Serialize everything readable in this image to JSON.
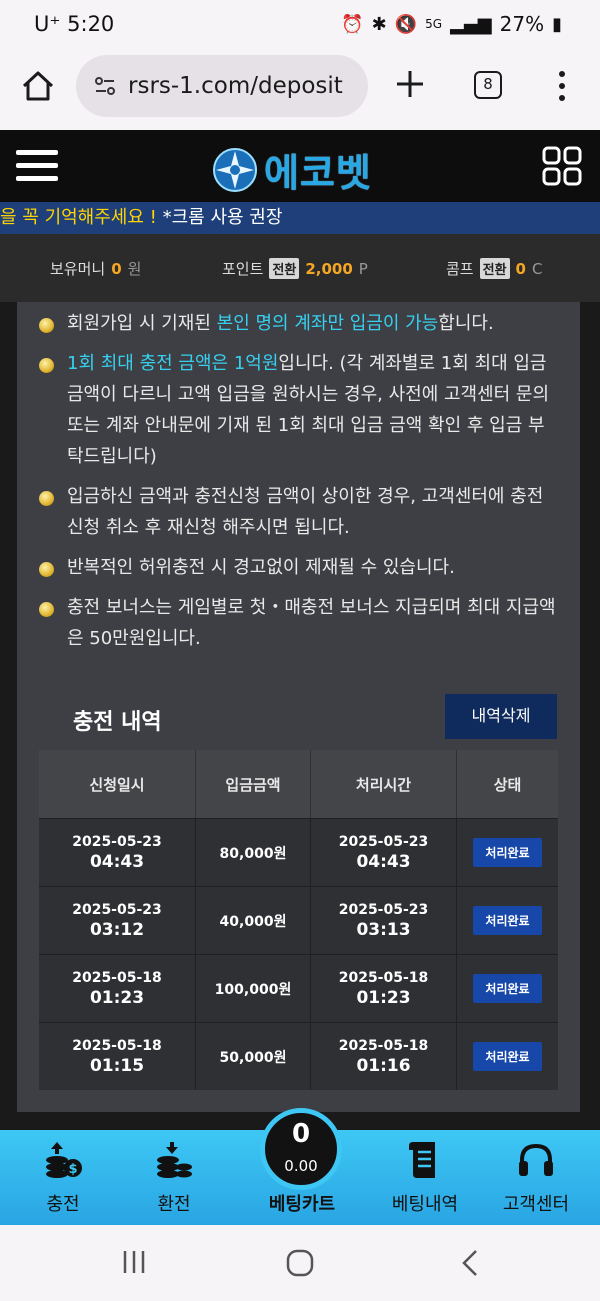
{
  "status_bar": {
    "carrier": "U⁺ 5:20",
    "battery": "27%",
    "network": "5G"
  },
  "browser": {
    "url": "rsrs-1.com/deposit",
    "tab_count": "8"
  },
  "site": {
    "logo_text": "에코벳"
  },
  "marquee": {
    "highlight": "을 꼭 기억해주세요 !",
    "text": " *크롬 사용 권장"
  },
  "balance": {
    "money_label": "보유머니",
    "money_value": "0",
    "money_unit": "원",
    "point_label": "포인트",
    "point_tag": "전환",
    "point_value": "2,000",
    "point_unit": "P",
    "comp_label": "콤프",
    "comp_tag": "전환",
    "comp_value": "0",
    "comp_unit": "C"
  },
  "notices": {
    "n1_pre": "회원가입 시 기재된 ",
    "n1_hl": "본인 명의 계좌만 입금이 가능",
    "n1_post": "합니다.",
    "n2_hl": "1회 최대 충전 금액은 1억원",
    "n2_post": "입니다. (각 계좌별로 1회 최대 입금 금액이 다르니 고액 입금을 원하시는 경우, 사전에 고객센터 문의 또는 계좌 안내문에 기재 된 1회 최대 입금 금액 확인 후 입금 부탁드립니다)",
    "n3": "입금하신 금액과 충전신청 금액이 상이한 경우, 고객센터에 충전신청 취소 후 재신청 해주시면 됩니다.",
    "n4": "반복적인 허위충전 시 경고없이 제재될 수 있습니다.",
    "n5": "충전 보너스는 게임별로 첫・매충전 보너스 지급되며 최대 지급액은 50만원입니다."
  },
  "history": {
    "title": "충전 내역",
    "delete_label": "내역삭제",
    "headers": [
      "신청일시",
      "입금금액",
      "처리시간",
      "상태"
    ],
    "rows": [
      {
        "req_date": "2025-05-23",
        "req_time": "04:43",
        "amount": "80,000원",
        "proc_date": "2025-05-23",
        "proc_time": "04:43",
        "status": "처리완료"
      },
      {
        "req_date": "2025-05-23",
        "req_time": "03:12",
        "amount": "40,000원",
        "proc_date": "2025-05-23",
        "proc_time": "03:13",
        "status": "처리완료"
      },
      {
        "req_date": "2025-05-18",
        "req_time": "01:23",
        "amount": "100,000원",
        "proc_date": "2025-05-18",
        "proc_time": "01:23",
        "status": "처리완료"
      },
      {
        "req_date": "2025-05-18",
        "req_time": "01:15",
        "amount": "50,000원",
        "proc_date": "2025-05-18",
        "proc_time": "01:16",
        "status": "처리완료"
      }
    ]
  },
  "bottom_nav": {
    "deposit": "충전",
    "withdraw": "환전",
    "cart": "베팅카트",
    "cart_count": "0",
    "cart_amount": "0.00",
    "bet_history": "베팅내역",
    "support": "고객센터"
  },
  "colors": {
    "accent": "#29a5e3",
    "highlight": "#36d0f0",
    "point": "#f5a623",
    "badge": "#1747a8"
  }
}
